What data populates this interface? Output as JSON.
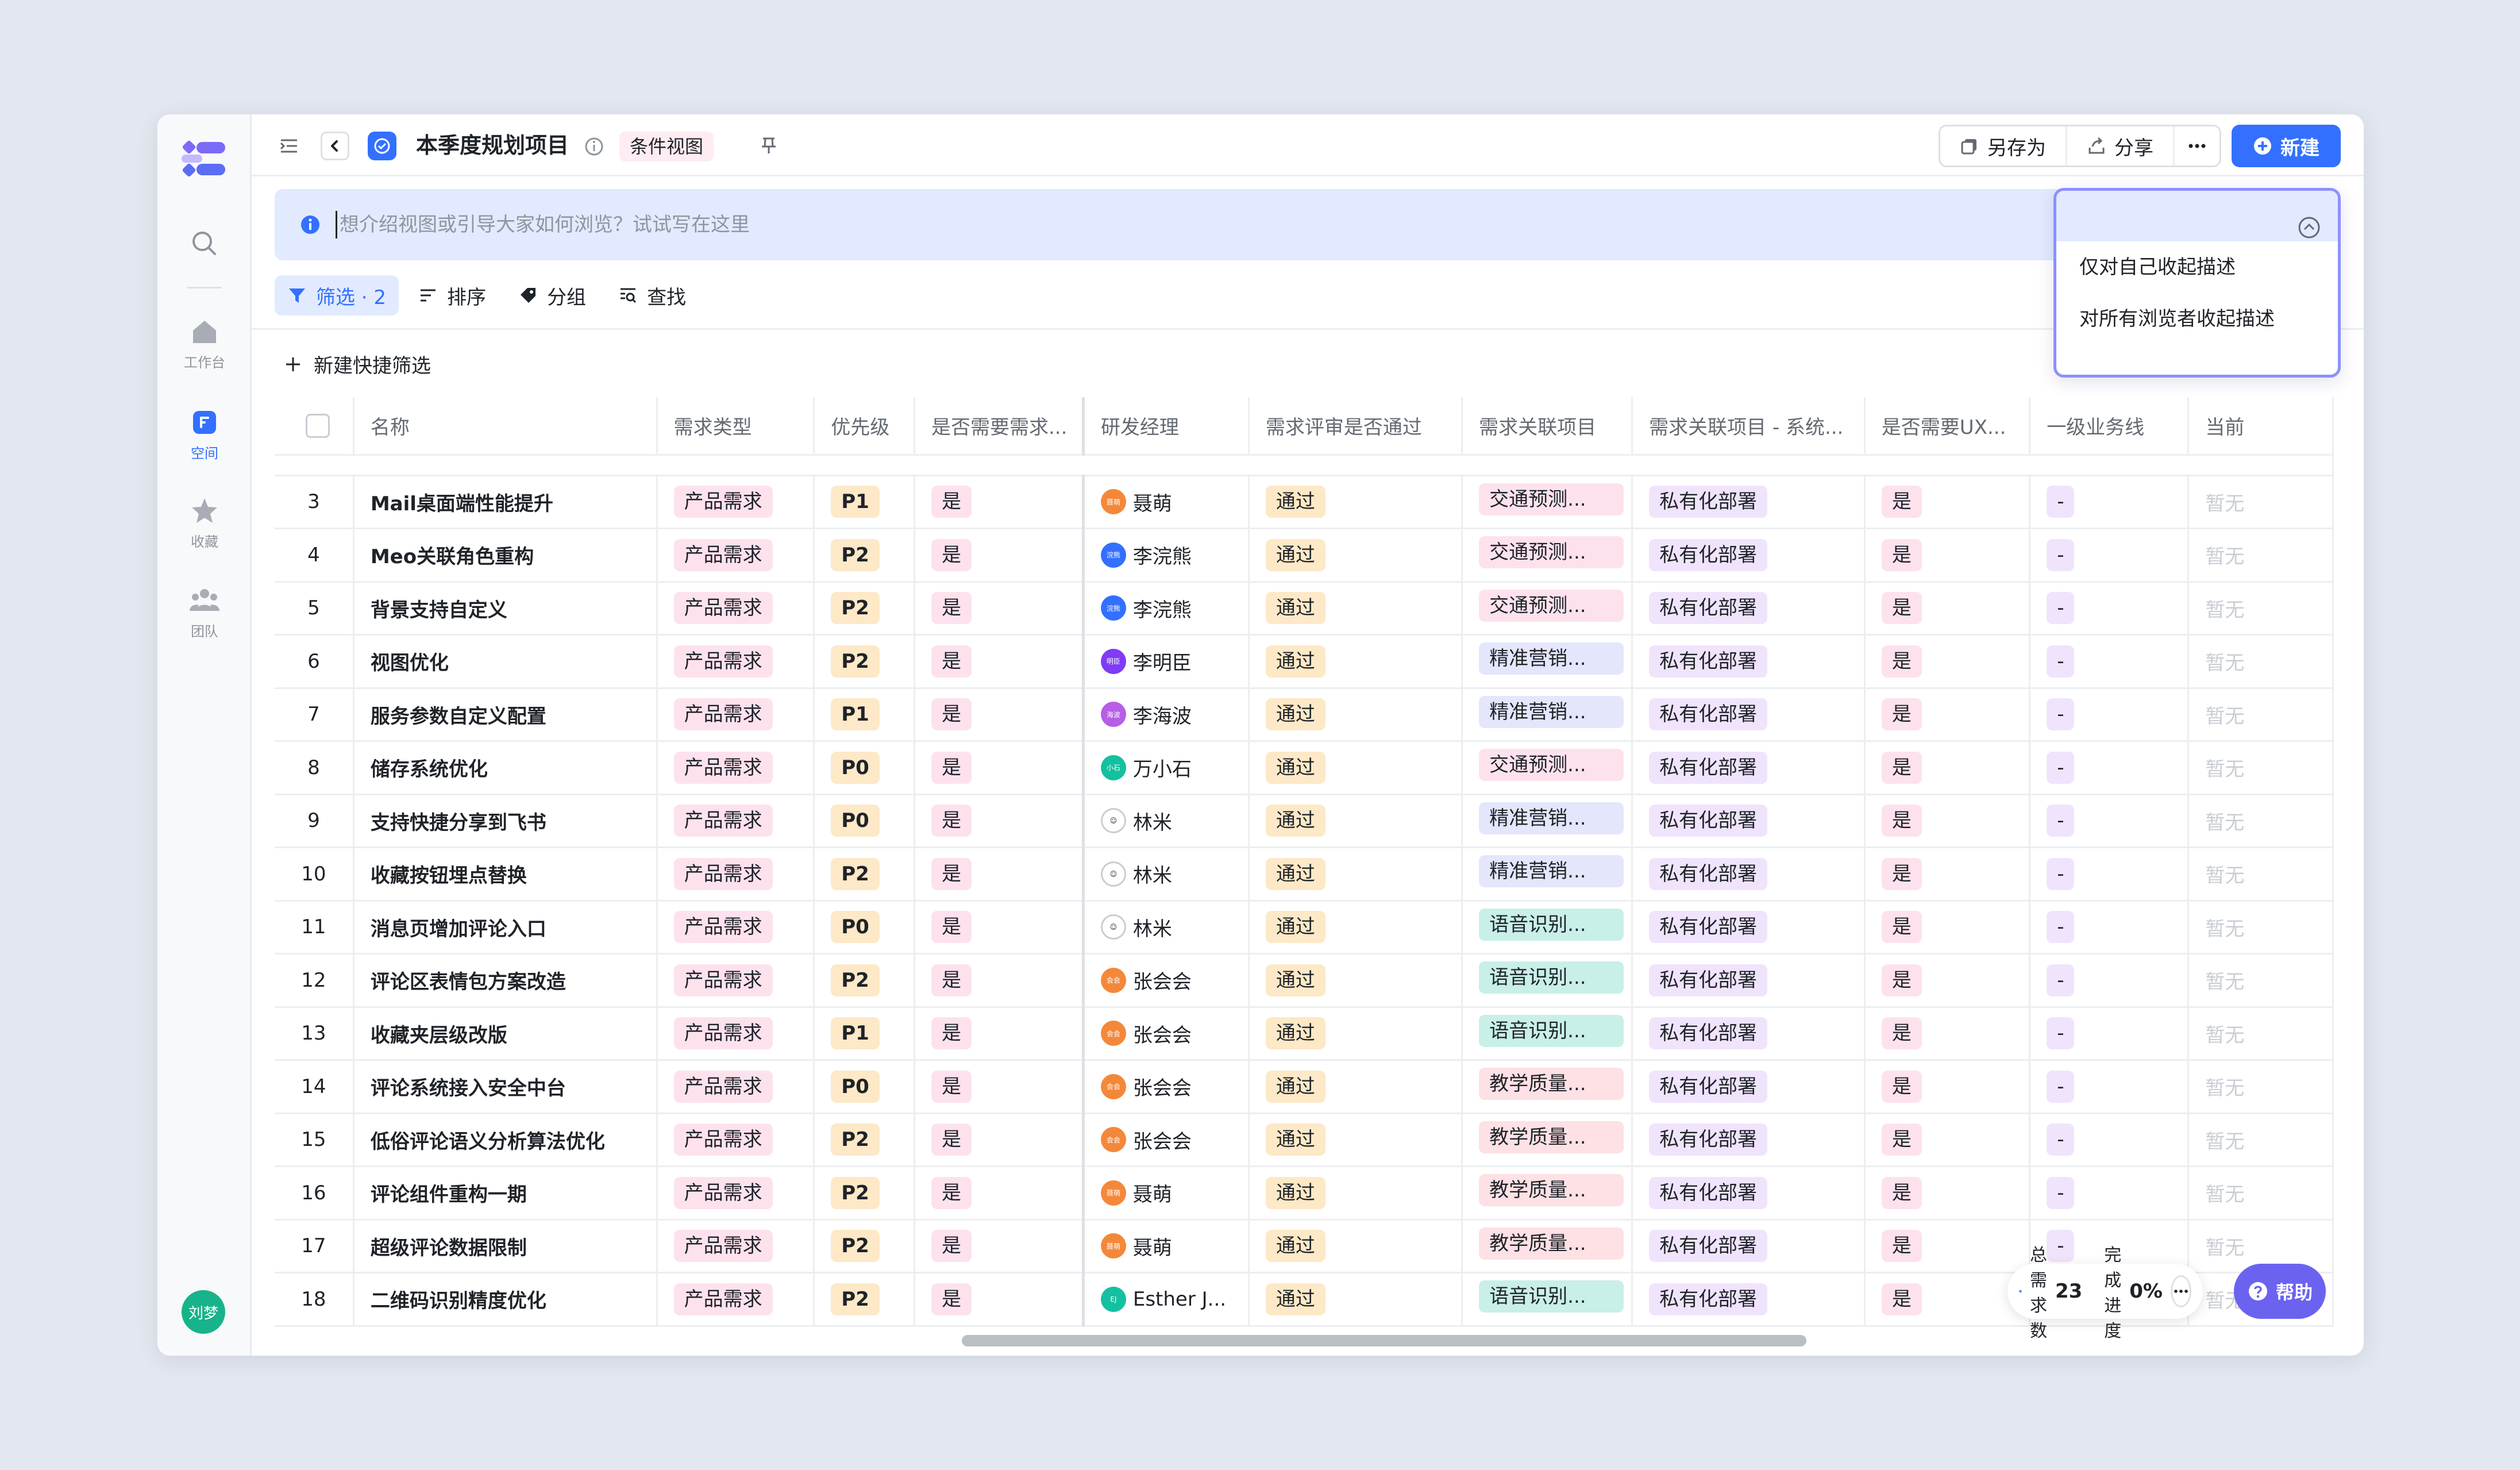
{
  "rail": {
    "items": [
      {
        "label": "工作台",
        "icon": "home-icon"
      },
      {
        "label": "空间",
        "icon": "space-icon",
        "active": true
      },
      {
        "label": "收藏",
        "icon": "star-icon"
      },
      {
        "label": "团队",
        "icon": "team-icon"
      }
    ],
    "avatar": "刘梦"
  },
  "header": {
    "title": "本季度规划项目",
    "view_tag": "条件视图",
    "save_as": "另存为",
    "share": "分享",
    "new": "新建"
  },
  "banner": {
    "placeholder": "想介绍视图或引导大家如何浏览？试试写在这里"
  },
  "popover": {
    "items": [
      "仅对自己收起描述",
      "对所有浏览者收起描述"
    ]
  },
  "toolbar": {
    "filter": "筛选 · 2",
    "sort": "排序",
    "group": "分组",
    "find": "查找",
    "quick_filter": "新建快捷筛选"
  },
  "table": {
    "columns": [
      "名称",
      "需求类型",
      "优先级",
      "是否需要需求...",
      "研发经理",
      "需求评审是否通过",
      "需求关联项目",
      "需求关联项目 - 系统...",
      "是否需要UX...",
      "一级业务线",
      "当前"
    ],
    "rows": [
      {
        "idx": "3",
        "name": "Mail桌面端性能提升",
        "type": "产品需求",
        "priority": "P1",
        "need": "是",
        "manager": "聂萌",
        "av": "聂萌",
        "avc": "#f4883a",
        "review": "通过",
        "project": "交通预测...",
        "pc": "pink",
        "system": "私有化部署",
        "ux": "是",
        "line": "-",
        "cur": "暂无"
      },
      {
        "idx": "4",
        "name": "Meo关联角色重构",
        "type": "产品需求",
        "priority": "P2",
        "need": "是",
        "manager": "李浣熊",
        "av": "浣熊",
        "avc": "#3370ff",
        "review": "通过",
        "project": "交通预测...",
        "pc": "pink",
        "system": "私有化部署",
        "ux": "是",
        "line": "-",
        "cur": "暂无"
      },
      {
        "idx": "5",
        "name": "背景支持自定义",
        "type": "产品需求",
        "priority": "P2",
        "need": "是",
        "manager": "李浣熊",
        "av": "浣熊",
        "avc": "#3370ff",
        "review": "通过",
        "project": "交通预测...",
        "pc": "pink",
        "system": "私有化部署",
        "ux": "是",
        "line": "-",
        "cur": "暂无"
      },
      {
        "idx": "6",
        "name": "视图优化",
        "type": "产品需求",
        "priority": "P2",
        "need": "是",
        "manager": "李明臣",
        "av": "明臣",
        "avc": "#7f3bf5",
        "review": "通过",
        "project": "精准营销...",
        "pc": "blue",
        "system": "私有化部署",
        "ux": "是",
        "line": "-",
        "cur": "暂无"
      },
      {
        "idx": "7",
        "name": "服务参数自定义配置",
        "type": "产品需求",
        "priority": "P1",
        "need": "是",
        "manager": "李海波",
        "av": "海波",
        "avc": "#b65ee6",
        "review": "通过",
        "project": "精准营销...",
        "pc": "blue",
        "system": "私有化部署",
        "ux": "是",
        "line": "-",
        "cur": "暂无"
      },
      {
        "idx": "8",
        "name": "储存系统优化",
        "type": "产品需求",
        "priority": "P0",
        "need": "是",
        "manager": "万小石",
        "av": "小石",
        "avc": "#14c0a0",
        "review": "通过",
        "project": "交通预测...",
        "pc": "pink",
        "system": "私有化部署",
        "ux": "是",
        "line": "-",
        "cur": "暂无"
      },
      {
        "idx": "9",
        "name": "支持快捷分享到飞书",
        "type": "产品需求",
        "priority": "P0",
        "need": "是",
        "manager": "林米",
        "av": "",
        "avc": "ghost",
        "review": "通过",
        "project": "精准营销...",
        "pc": "blue",
        "system": "私有化部署",
        "ux": "是",
        "line": "-",
        "cur": "暂无"
      },
      {
        "idx": "10",
        "name": "收藏按钮埋点替换",
        "type": "产品需求",
        "priority": "P2",
        "need": "是",
        "manager": "林米",
        "av": "",
        "avc": "ghost",
        "review": "通过",
        "project": "精准营销...",
        "pc": "blue",
        "system": "私有化部署",
        "ux": "是",
        "line": "-",
        "cur": "暂无"
      },
      {
        "idx": "11",
        "name": "消息页增加评论入口",
        "type": "产品需求",
        "priority": "P0",
        "need": "是",
        "manager": "林米",
        "av": "",
        "avc": "ghost",
        "review": "通过",
        "project": "语音识别...",
        "pc": "teal",
        "system": "私有化部署",
        "ux": "是",
        "line": "-",
        "cur": "暂无"
      },
      {
        "idx": "12",
        "name": "评论区表情包方案改造",
        "type": "产品需求",
        "priority": "P2",
        "need": "是",
        "manager": "张会会",
        "av": "会会",
        "avc": "#f4883a",
        "review": "通过",
        "project": "语音识别...",
        "pc": "teal",
        "system": "私有化部署",
        "ux": "是",
        "line": "-",
        "cur": "暂无"
      },
      {
        "idx": "13",
        "name": "收藏夹层级改版",
        "type": "产品需求",
        "priority": "P1",
        "need": "是",
        "manager": "张会会",
        "av": "会会",
        "avc": "#f4883a",
        "review": "通过",
        "project": "语音识别...",
        "pc": "teal",
        "system": "私有化部署",
        "ux": "是",
        "line": "-",
        "cur": "暂无"
      },
      {
        "idx": "14",
        "name": "评论系统接入安全中台",
        "type": "产品需求",
        "priority": "P0",
        "need": "是",
        "manager": "张会会",
        "av": "会会",
        "avc": "#f4883a",
        "review": "通过",
        "project": "教学质量...",
        "pc": "rose",
        "system": "私有化部署",
        "ux": "是",
        "line": "-",
        "cur": "暂无"
      },
      {
        "idx": "15",
        "name": "低俗评论语义分析算法优化",
        "type": "产品需求",
        "priority": "P2",
        "need": "是",
        "manager": "张会会",
        "av": "会会",
        "avc": "#f4883a",
        "review": "通过",
        "project": "教学质量...",
        "pc": "rose",
        "system": "私有化部署",
        "ux": "是",
        "line": "-",
        "cur": "暂无"
      },
      {
        "idx": "16",
        "name": "评论组件重构一期",
        "type": "产品需求",
        "priority": "P2",
        "need": "是",
        "manager": "聂萌",
        "av": "聂萌",
        "avc": "#f4883a",
        "review": "通过",
        "project": "教学质量...",
        "pc": "rose",
        "system": "私有化部署",
        "ux": "是",
        "line": "-",
        "cur": "暂无"
      },
      {
        "idx": "17",
        "name": "超级评论数据限制",
        "type": "产品需求",
        "priority": "P2",
        "need": "是",
        "manager": "聂萌",
        "av": "聂萌",
        "avc": "#f4883a",
        "review": "通过",
        "project": "教学质量...",
        "pc": "rose",
        "system": "私有化部署",
        "ux": "是",
        "line": "-",
        "cur": "暂无"
      },
      {
        "idx": "18",
        "name": "二维码识别精度优化",
        "type": "产品需求",
        "priority": "P2",
        "need": "是",
        "manager": "Esther J...",
        "av": "EJ",
        "avc": "#14c0a0",
        "review": "通过",
        "project": "语音识别...",
        "pc": "teal",
        "system": "私有化部署",
        "ux": "是",
        "line": "-",
        "cur": "暂无"
      }
    ]
  },
  "stats": {
    "total_label": "总需求数",
    "total": "23",
    "progress_label": "完成进度",
    "progress": "0%"
  },
  "help": "帮助",
  "colors": {
    "accent": "#3370ff",
    "help": "#6b63f0",
    "popover_border": "#8c90ff"
  }
}
